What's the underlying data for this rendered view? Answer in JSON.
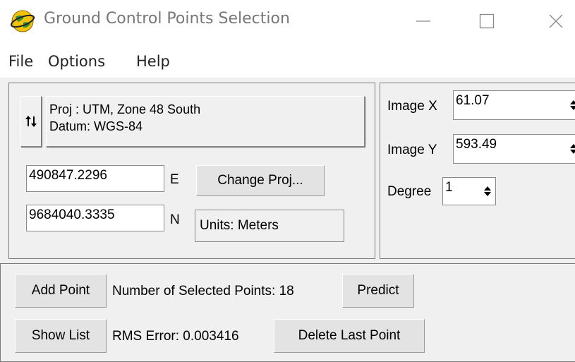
{
  "window": {
    "title": "Ground Control Points Selection",
    "icon": "globe-icon",
    "controls": {
      "minimize": "minimize-icon",
      "maximize": "maximize-icon",
      "close": "close-icon"
    }
  },
  "menu": {
    "file": "File",
    "options": "Options",
    "help": "Help"
  },
  "projection": {
    "swap_icon": "swap-arrows-icon",
    "proj_line": "Proj : UTM, Zone 48 South",
    "datum_line": "Datum: WGS-84",
    "easting_value": "490847.2296",
    "easting_label": "E",
    "northing_value": "9684040.3335",
    "northing_label": "N",
    "change_proj_label": "Change Proj...",
    "units_text": "Units: Meters"
  },
  "image_coords": {
    "x_label": "Image X",
    "x_value": "61.07",
    "y_label": "Image Y",
    "y_value": "593.49",
    "degree_label": "Degree",
    "degree_value": "1"
  },
  "actions": {
    "add_point_label": "Add Point",
    "num_selected_text": "Number of Selected Points: 18",
    "predict_label": "Predict",
    "show_list_label": "Show List",
    "rms_error_text": "RMS Error: 0.003416",
    "delete_last_label": "Delete Last Point"
  },
  "colors": {
    "background": "#f0f0f0",
    "titlebar": "#ffffff",
    "globe_yellow": "#f4c20d",
    "globe_green": "#2e8b3a"
  }
}
